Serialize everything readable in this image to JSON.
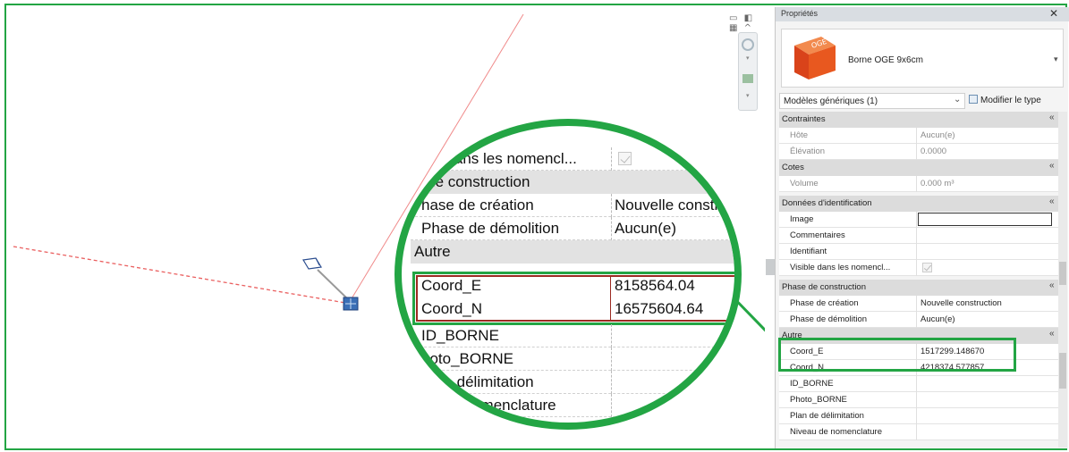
{
  "panel": {
    "title": "Propriétés",
    "close": "✕",
    "type_name": "Borne OGE 9x6cm",
    "type_thumb_text": "OGE",
    "type_dropdown": "▾",
    "filter_value": "Modèles génériques (1)",
    "filter_dropdown": "⌄",
    "edit_type_label": "Modifier le type",
    "collapse": "«",
    "sections": {
      "constraints": {
        "label": "Contraintes",
        "host": {
          "name": "Hôte",
          "value": "Aucun(e)"
        },
        "elevation": {
          "name": "Élévation",
          "value": "0.0000"
        }
      },
      "dimensions": {
        "label": "Cotes",
        "volume": {
          "name": "Volume",
          "value": "0.000 m³"
        }
      },
      "identity": {
        "label": "Données d'identification",
        "image": {
          "name": "Image"
        },
        "comments": {
          "name": "Commentaires"
        },
        "mark": {
          "name": "Identifiant"
        },
        "schedules": {
          "name": "Visible dans les nomencl..."
        }
      },
      "phasing": {
        "label": "Phase de construction",
        "created": {
          "name": "Phase de création",
          "value": "Nouvelle construction"
        },
        "demolished": {
          "name": "Phase de démolition",
          "value": "Aucun(e)"
        }
      },
      "other": {
        "label": "Autre",
        "coord_e": {
          "name": "Coord_E",
          "value": "1517299.148670"
        },
        "coord_n": {
          "name": "Coord_N",
          "value": "4218374.577857"
        },
        "id_borne": {
          "name": "ID_BORNE"
        },
        "photo_borne": {
          "name": "Photo_BORNE"
        },
        "plan": {
          "name": "Plan de délimitation"
        },
        "niveau": {
          "name": "Niveau de nomenclature"
        }
      }
    }
  },
  "zoom": {
    "schedules_name": "ble dans les nomencl...",
    "phasing_label": "e de construction",
    "created_name": "hase de création",
    "created_value": "Nouvelle constr",
    "demolished_name": "Phase de démolition",
    "demolished_value": "Aucun(e)",
    "other_label": "Autre",
    "coord_e_name": "Coord_E",
    "coord_e_value": "8158564.04",
    "coord_n_name": "Coord_N",
    "coord_n_value": "16575604.64",
    "id_borne_name": "ID_BORNE",
    "photo_borne_name": "hoto_BORNE",
    "plan_name": "de délimitation",
    "niveau_name": "de nomenclature"
  },
  "view_controls": {
    "text": "▭ ◧ ▦ ^"
  },
  "colors": {
    "highlight": "#23a544",
    "zoom_box": "#9c2b22",
    "ref_line": "#f08a8a",
    "element": "#3b6fb6",
    "thumb": "#e0521f"
  }
}
